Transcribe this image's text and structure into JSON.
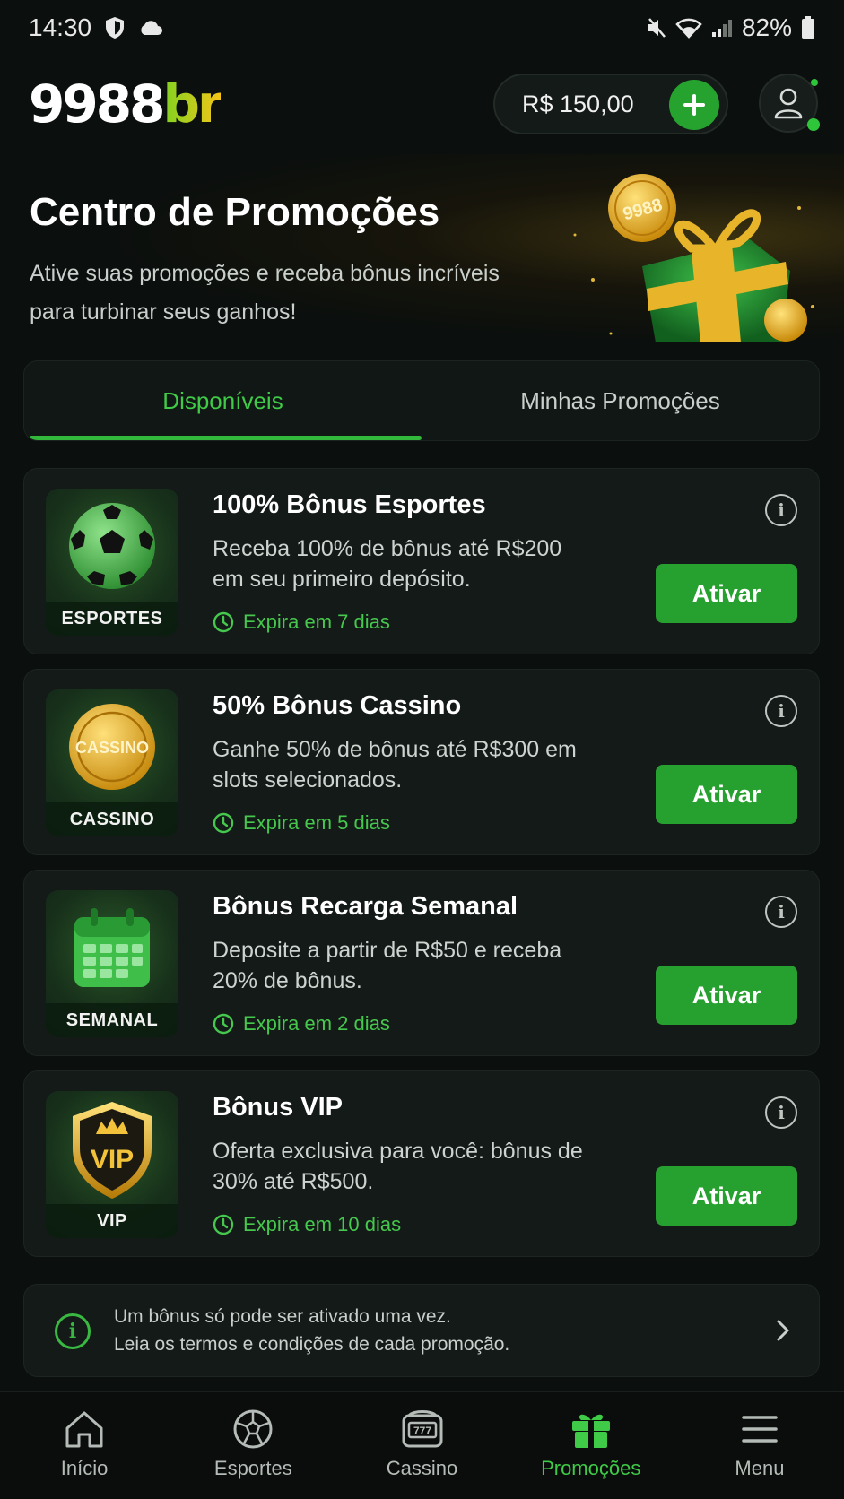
{
  "status_bar": {
    "time": "14:30",
    "battery": "82%"
  },
  "header": {
    "logo_main": "9988",
    "logo_suffix": "br",
    "balance": "R$ 150,00"
  },
  "hero": {
    "title": "Centro de Promoções",
    "subtitle": "Ative suas promoções e receba bônus incríveis para turbinar seus ganhos!",
    "coin_label": "9988"
  },
  "tabs": [
    {
      "label": "Disponíveis",
      "active": true
    },
    {
      "label": "Minhas Promoções",
      "active": false
    }
  ],
  "promotions": [
    {
      "tag": "ESPORTES",
      "icon": "soccer-ball-icon",
      "title": "100% Bônus Esportes",
      "description": "Receba 100% de bônus até R$200 em seu primeiro depósito.",
      "expires": "Expira em 7 dias",
      "button": "Ativar"
    },
    {
      "tag": "CASSINO",
      "icon": "casino-coin-icon",
      "coin_text": "CASSINO",
      "title": "50% Bônus Cassino",
      "description": "Ganhe 50% de bônus até R$300 em slots selecionados.",
      "expires": "Expira em 5 dias",
      "button": "Ativar"
    },
    {
      "tag": "SEMANAL",
      "icon": "calendar-icon",
      "title": "Bônus Recarga Semanal",
      "description": "Deposite a partir de R$50 e receba 20% de bônus.",
      "expires": "Expira em 2 dias",
      "button": "Ativar"
    },
    {
      "tag": "VIP",
      "icon": "vip-shield-icon",
      "badge_text": "VIP",
      "title": "Bônus VIP",
      "description": "Oferta exclusiva para você: bônus de 30% até R$500.",
      "expires": "Expira em 10 dias",
      "button": "Ativar"
    }
  ],
  "notice": {
    "line1": "Um bônus só pode ser ativado uma vez.",
    "line2": "Leia os termos e condições de cada promoção."
  },
  "bottom_nav": [
    {
      "label": "Início",
      "icon": "home-icon",
      "active": false
    },
    {
      "label": "Esportes",
      "icon": "soccer-ball-icon",
      "active": false
    },
    {
      "label": "Cassino",
      "icon": "slot-machine-icon",
      "active": false
    },
    {
      "label": "Promoções",
      "icon": "gift-icon",
      "active": true
    },
    {
      "label": "Menu",
      "icon": "menu-icon",
      "active": false
    }
  ],
  "colors": {
    "accent": "#26a02f",
    "accent_text": "#3fca47",
    "background": "#0b0f0d",
    "card": "#141a17"
  }
}
